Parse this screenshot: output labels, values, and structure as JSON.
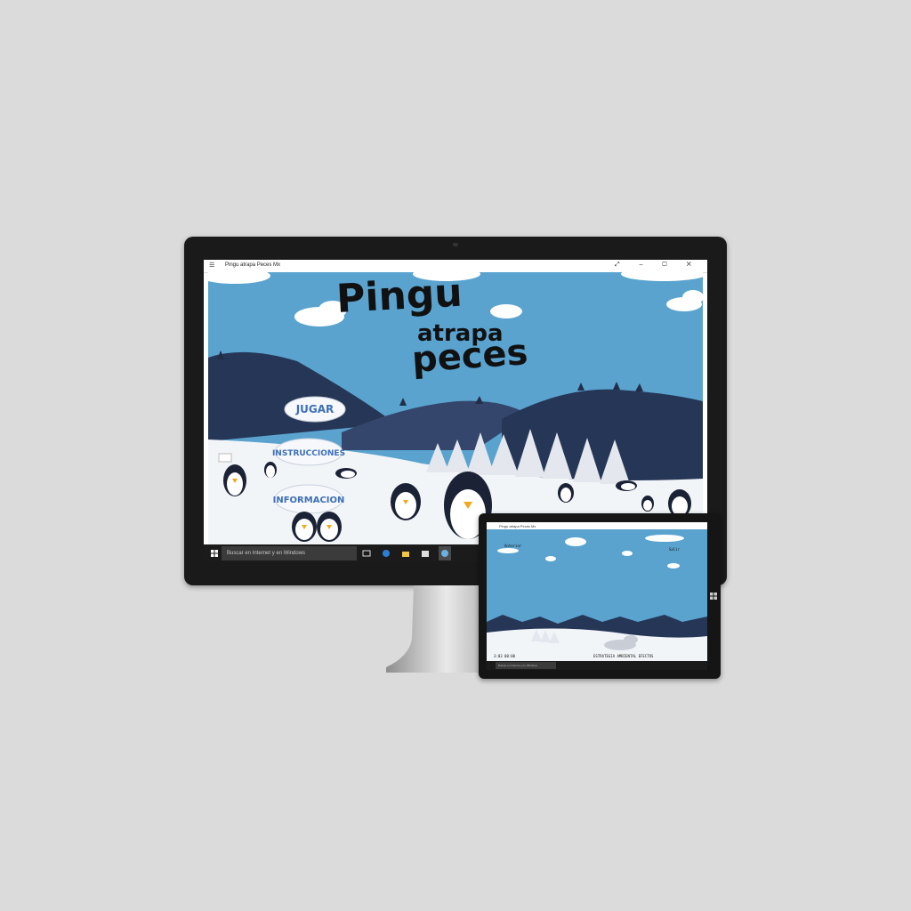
{
  "monitor": {
    "window_title": "Pingu atrapa Peces Mx",
    "window_controls": [
      "⤢",
      "–",
      "▢",
      "✕"
    ],
    "game": {
      "title_line1": "Pingu",
      "title_line2": "atrapa",
      "title_line3": "peces",
      "menu": {
        "play_label": "JUGAR",
        "instructions_label": "INSTRUCCIONES",
        "info_label": "INFORMACION"
      }
    },
    "taskbar": {
      "search_placeholder": "Buscar en Internet y en Windows"
    }
  },
  "tablet": {
    "window_title": "Pingu atrapa Peces Mx",
    "hud_left": "Anterior",
    "hud_right": "Salir",
    "status_left": "3:03  00:00",
    "status_right": "ESTRATEGIA   AMBIENTAL   EFECTOS",
    "taskbar_search": "Buscar en Internet y en Windows"
  },
  "colors": {
    "sky": "#5aa3cf",
    "mountain_dark": "#263656",
    "mountain_mid": "#34466b",
    "snow": "#f2f5f8",
    "button_text": "#3d6fb6"
  }
}
